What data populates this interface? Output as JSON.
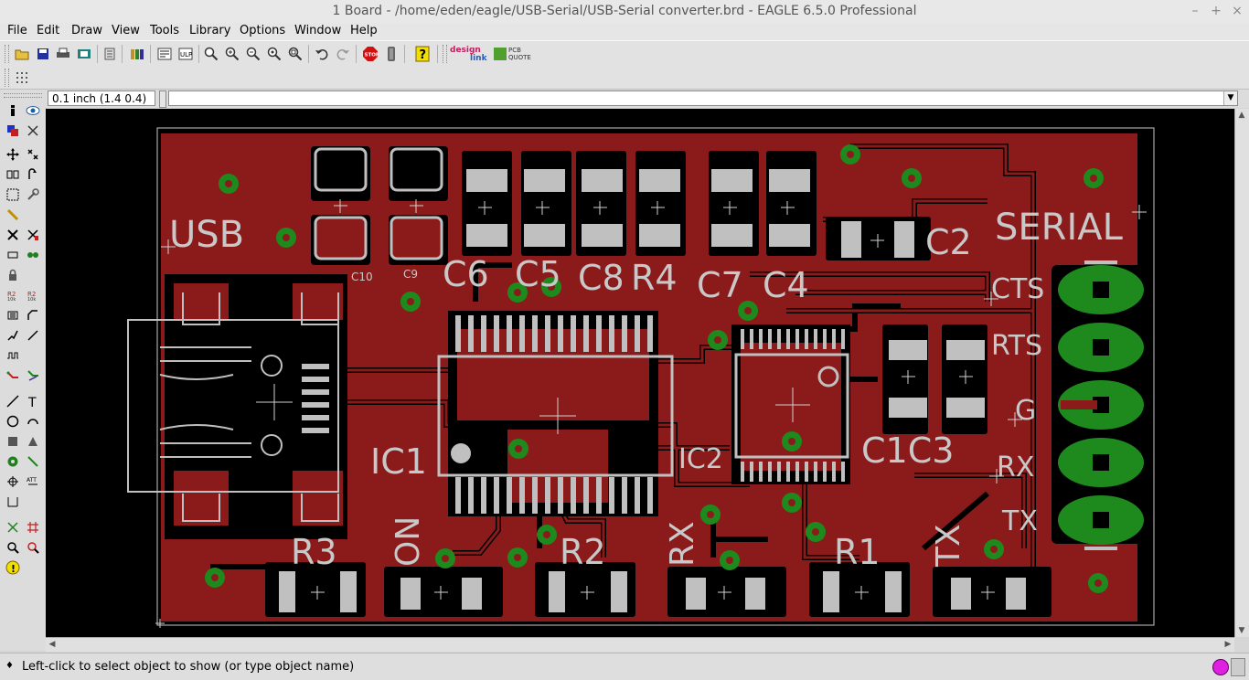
{
  "window": {
    "title": "1 Board - /home/eden/eagle/USB-Serial/USB-Serial converter.brd - EAGLE 6.5.0 Professional",
    "controls": [
      "–",
      "+",
      "×"
    ]
  },
  "menu": [
    "File",
    "Edit",
    "Draw",
    "View",
    "Tools",
    "Library",
    "Options",
    "Window",
    "Help"
  ],
  "toolbar": {
    "icons": [
      "open-icon",
      "save-icon",
      "print-icon",
      "cam-icon",
      "script-icon",
      "library-icon",
      "ulp-icon",
      "zoom-fit-icon",
      "zoom-in-icon",
      "zoom-out-icon",
      "zoom-redraw-icon",
      "zoom-select-icon",
      "undo-icon",
      "redo-icon",
      "stop-icon",
      "go-icon",
      "help-icon",
      "design-link-icon",
      "pcb-quote-icon"
    ],
    "design_link_label": "design",
    "design_link_label2": "link",
    "pcb_quote_label": "PCB",
    "pcb_quote_label2": "QUOTE"
  },
  "command": {
    "coordinates": "0.1 inch (1.4 0.4)",
    "input_value": ""
  },
  "status": {
    "message": "Left-click to select object to show (or type object name)",
    "indicator_color": "#e020e0"
  },
  "board": {
    "labels": {
      "usb": "USB",
      "serial": "SERIAL",
      "c10": "C10",
      "c9": "C9",
      "c6": "C6",
      "c5": "C5",
      "c8": "C8",
      "r4": "R4",
      "c7": "C7",
      "c4": "C4",
      "c2": "C2",
      "cts": "CTS",
      "rts": "RTS",
      "g": "G",
      "rx_pin": "RX",
      "tx_pin": "TX",
      "ic1": "IC1",
      "ic2": "IC2",
      "c1c3": "C1C3",
      "r3": "R3",
      "r2": "R2",
      "r1": "R1",
      "on": "ON",
      "rx_led": "RX",
      "tx_led": "TX"
    },
    "colors": {
      "copper": "#8b1a1a",
      "silkscreen": "#c0c0c0",
      "via": "#1e8a1e",
      "background": "#000000"
    }
  }
}
